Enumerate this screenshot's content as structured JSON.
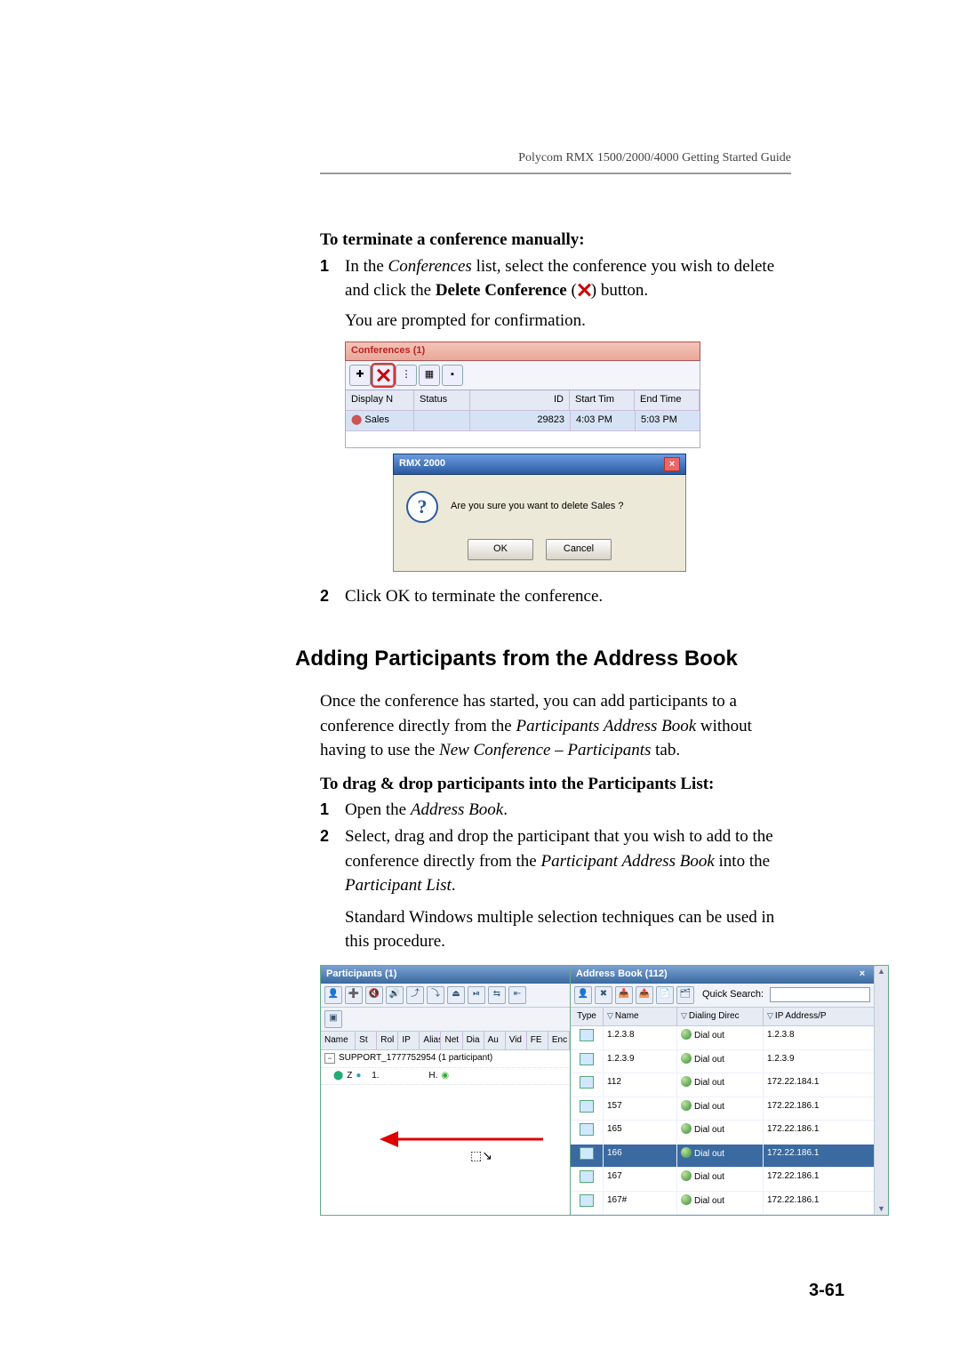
{
  "header": {
    "guide_title": "Polycom RMX 1500/2000/4000 Getting Started Guide"
  },
  "page_number": "3-61",
  "sec1": {
    "lead_bold": "To terminate a conference manually:",
    "step1_a": "In the ",
    "step1_conf_italic": "Conferences",
    "step1_b": " list, select the conference you wish to delete and click the ",
    "step1_delconf_bold": "Delete Conference",
    "step1_c": " (",
    "step1_d": ") button.",
    "step1_e": "You are prompted for confirmation.",
    "step2": "Click OK to terminate the conference."
  },
  "conf_panel": {
    "title": "Conferences (1)",
    "head": {
      "dn": "Display N",
      "status": "Status",
      "id": "ID",
      "start": "Start Tim",
      "end": "End Time"
    },
    "row": {
      "dn": "Sales",
      "status": "",
      "id": "29823",
      "start": "4:03 PM",
      "end": "5:03 PM"
    },
    "dialog": {
      "title": "RMX 2000",
      "message": "Are you sure you want to delete Sales ?",
      "ok": "OK",
      "cancel": "Cancel"
    }
  },
  "sec2": {
    "heading": "Adding Participants from the Address Book",
    "p1_a": "Once the conference has started, you can add participants to a conference directly from the ",
    "p1_i1": "Participants Address Book",
    "p1_b": " without having to use the ",
    "p1_i2": "New Conference – Participants",
    "p1_c": " tab.",
    "lead_bold": "To drag & drop participants into the Participants List:",
    "s1_a": "Open the ",
    "s1_i": "Address Book",
    "s1_b": ".",
    "s2_a": "Select, drag and drop the participant that you wish to add to the conference directly from the ",
    "s2_i1": "Participant Address Book",
    "s2_b": " into the ",
    "s2_i2": "Participant List",
    "s2_c": ".",
    "s2_d": "Standard Windows multiple selection techniques can be used in this procedure."
  },
  "participants_panel": {
    "title": "Participants (1)",
    "columns": [
      "Name",
      "St",
      "Rol",
      "IP",
      "Alias",
      "Net",
      "Dia",
      "Au",
      "Vid",
      "FE",
      "Enc"
    ],
    "group": "SUPPORT_1777752954 (1 participant)",
    "row": {
      "name": "Z",
      "ip": "1.",
      "au": "H."
    }
  },
  "address_book_panel": {
    "title": "Address Book (112)",
    "quick_search_label": "Quick Search:",
    "columns": {
      "type": "Type",
      "name": "Name",
      "dialdir": "Dialing Direc",
      "ip": "IP Address/P"
    },
    "rows": [
      {
        "name": "1.2.3.8",
        "dialdir": "Dial out",
        "ip": "1.2.3.8",
        "sel": false
      },
      {
        "name": "1.2.3.9",
        "dialdir": "Dial out",
        "ip": "1.2.3.9",
        "sel": false
      },
      {
        "name": "112",
        "dialdir": "Dial out",
        "ip": "172.22.184.1",
        "sel": false
      },
      {
        "name": "157",
        "dialdir": "Dial out",
        "ip": "172.22.186.1",
        "sel": false
      },
      {
        "name": "165",
        "dialdir": "Dial out",
        "ip": "172.22.186.1",
        "sel": false
      },
      {
        "name": "166",
        "dialdir": "Dial out",
        "ip": "172.22.186.1",
        "sel": true
      },
      {
        "name": "167",
        "dialdir": "Dial out",
        "ip": "172.22.186.1",
        "sel": false
      },
      {
        "name": "167#",
        "dialdir": "Dial out",
        "ip": "172.22.186.1",
        "sel": false
      }
    ]
  }
}
